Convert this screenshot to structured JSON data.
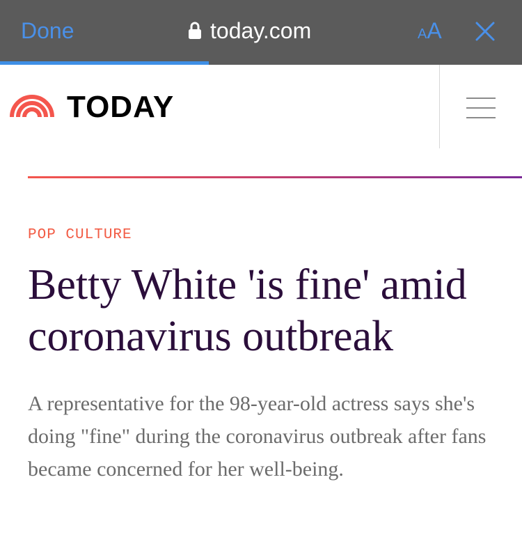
{
  "browser": {
    "done_label": "Done",
    "url": "today.com",
    "text_size_small": "A",
    "text_size_large": "A",
    "lock_icon": "lock-icon",
    "close_icon": "close-icon",
    "accent_color": "#4a90e8",
    "load_progress_percent": 40
  },
  "site": {
    "brand": "TODAY",
    "logo_icon": "today-sunrise-logo-icon",
    "menu_icon": "hamburger-menu-icon"
  },
  "article": {
    "category": "POP CULTURE",
    "headline": "Betty White 'is fine' amid coronavirus outbreak",
    "dek": "A representative for the 98-year-old actress says she's doing \"fine\" during the coronavirus outbreak after fans became concerned for her well-being.",
    "category_color": "#f25c45",
    "headline_color": "#2b0e3b"
  }
}
